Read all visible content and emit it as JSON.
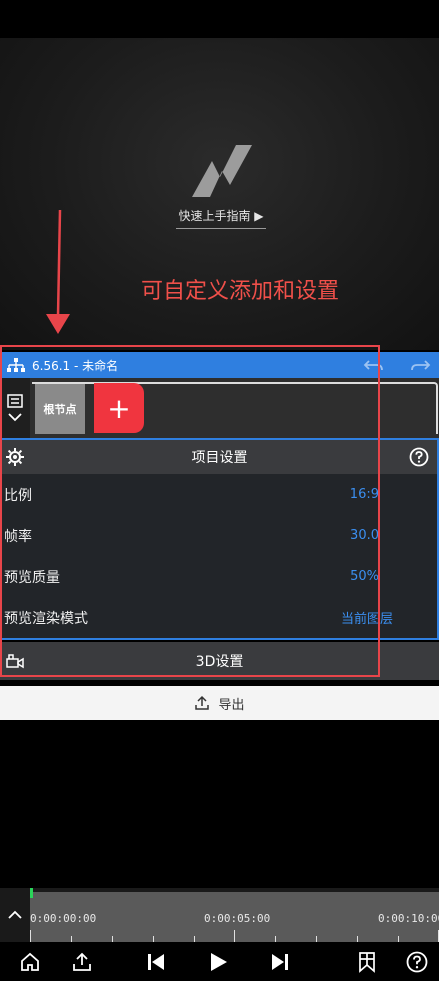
{
  "preview": {
    "guide_label": "快速上手指南 ▶",
    "annotation": "可自定义添加和设置"
  },
  "titlebar": {
    "title": "6.56.1 - 未命名"
  },
  "nodes": {
    "root_label": "根节点",
    "add_label": "+"
  },
  "settings": {
    "title": "项目设置",
    "rows": [
      {
        "label": "比例",
        "value": "16:9"
      },
      {
        "label": "帧率",
        "value": "30.0"
      },
      {
        "label": "预览质量",
        "value": "50%"
      },
      {
        "label": "预览渲染模式",
        "value": "当前图层"
      }
    ]
  },
  "d3": {
    "label": "3D设置"
  },
  "export": {
    "label": "导出"
  },
  "timeline": {
    "timecodes": [
      "0:00:00:00",
      "0:00:05:00",
      "0:00:10:00"
    ]
  },
  "colors": {
    "accent": "#2f7fe0",
    "annotation": "#e8454a",
    "add": "#f0353f",
    "value": "#3b8ff0"
  },
  "icons": {
    "titlebar": "node-tree-icon",
    "undo": "undo-icon",
    "redo": "redo-icon",
    "settings": "gear-icon",
    "help": "help-icon",
    "camera": "camera-icon",
    "export": "upload-icon",
    "toolbar": [
      "home-icon",
      "share-icon",
      "skip-start-icon",
      "play-icon",
      "skip-end-icon",
      "bookmark-icon",
      "help-icon"
    ]
  }
}
